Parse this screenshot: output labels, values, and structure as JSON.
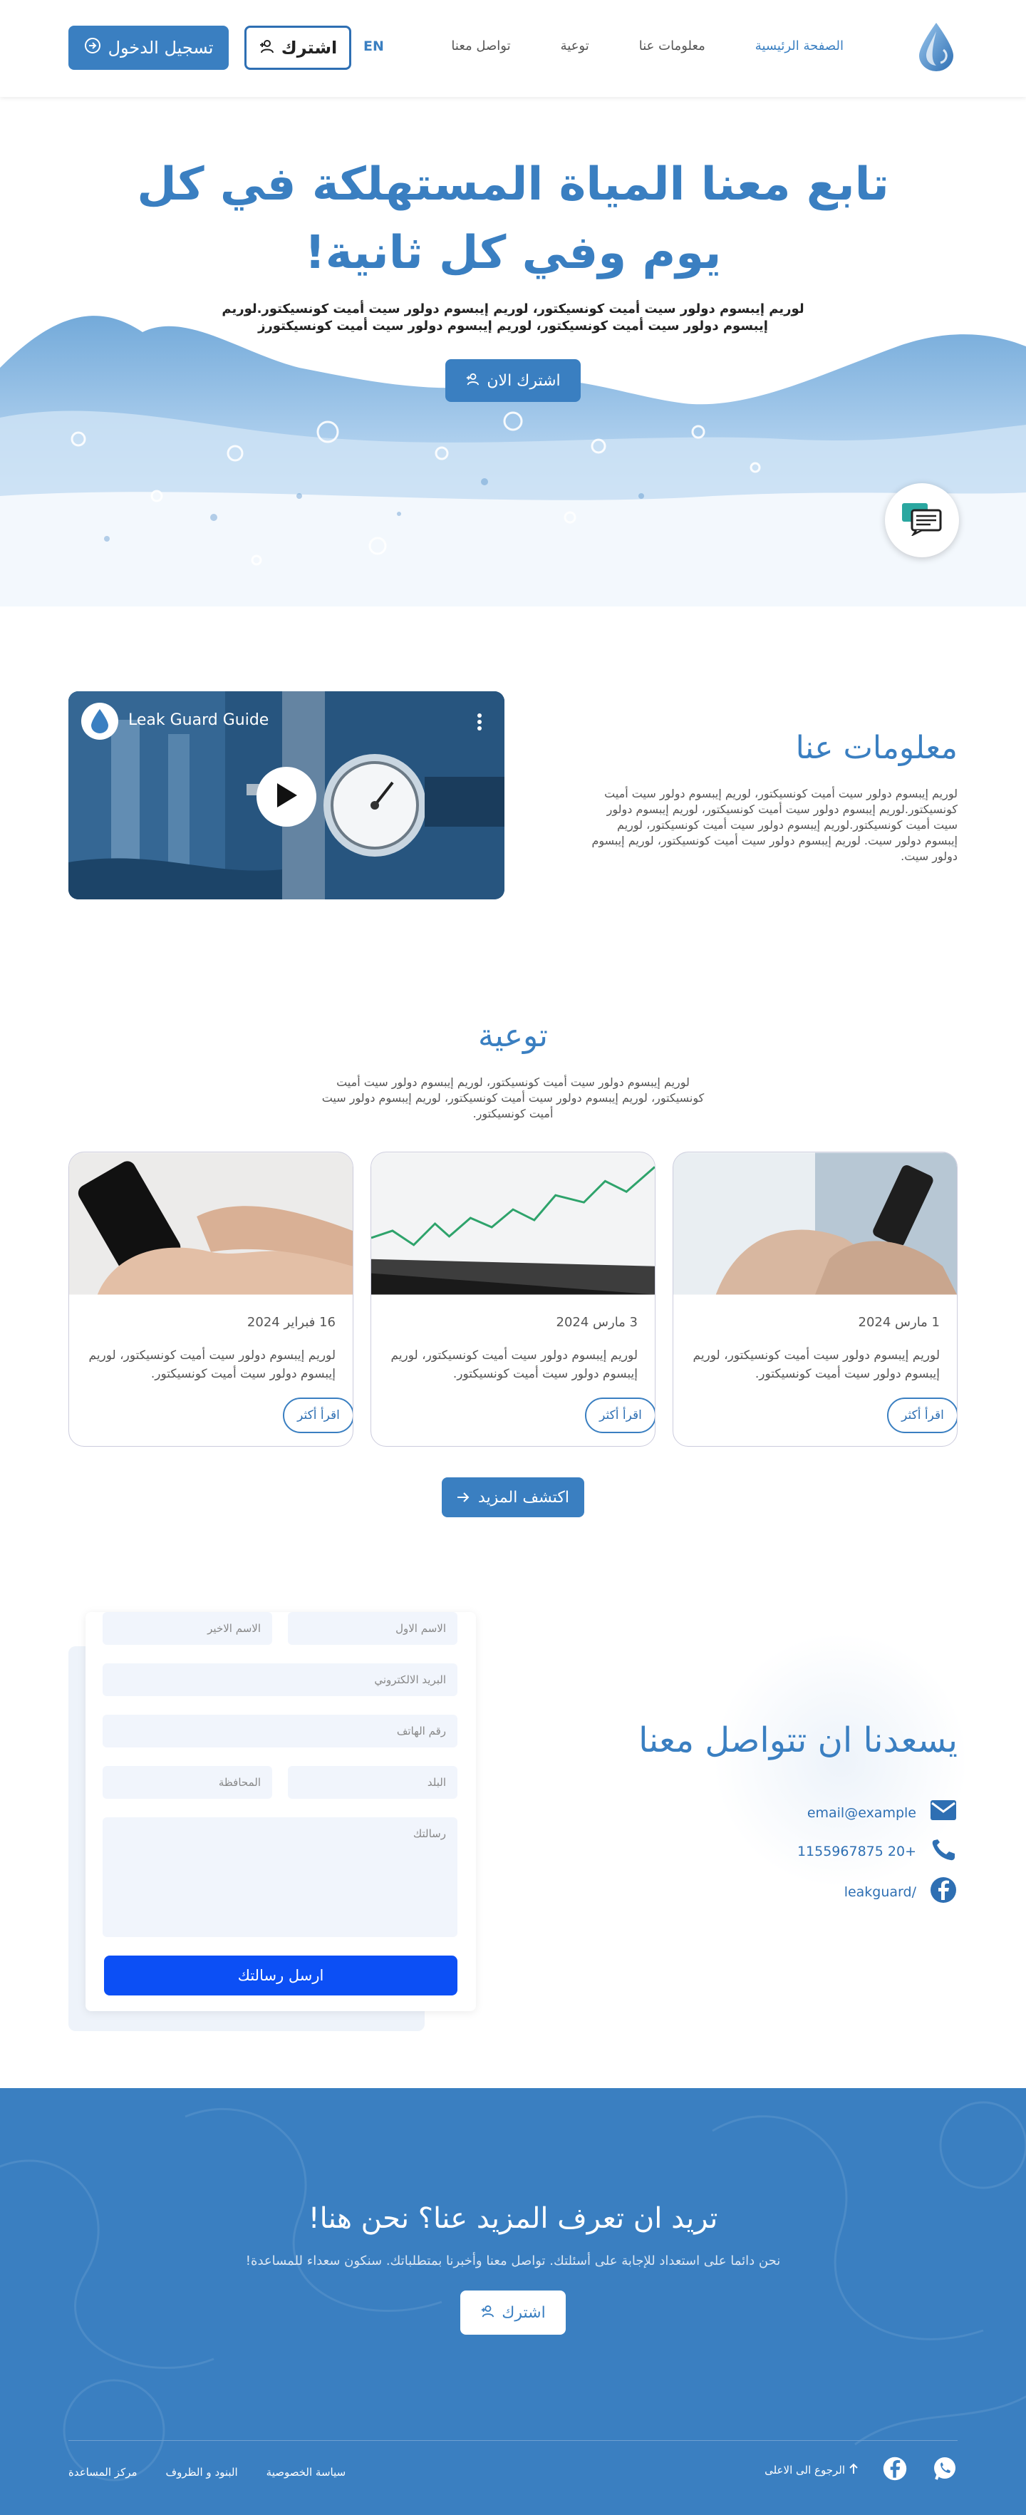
{
  "nav": {
    "items": [
      {
        "label": "الصفحة الرئيسية",
        "active": true
      },
      {
        "label": "معلومات عنا",
        "active": false
      },
      {
        "label": "توعية",
        "active": false
      },
      {
        "label": "تواصل معنا",
        "active": false
      }
    ],
    "lang": "EN",
    "subscribe_label": "اشترك",
    "login_label": "تسجيل الدخول"
  },
  "hero": {
    "title_line1": "تابع معنا المياة المستهلكة في كل",
    "title_line2": "يوم وفي كل ثانية!",
    "text": "لوريم إيبسوم دولور سيت أميت كونسيكتور، لوريم إيبسوم دولور سيت أميت كونسيكتور.لوريم إيبسوم دولور سيت أميت كونسيكتور، لوريم إيبسوم دولور سيت أميت كونسيكتورز",
    "cta_label": "اشترك الان"
  },
  "about": {
    "title": "معلومات عنا",
    "text": "لوريم إيبسوم دولور سيت أميت كونسيكتور، لوريم إيبسوم دولور سيت أميت كونسيكتور.لوريم إيبسوم دولور سيت أميت كونسيكتور، لوريم إيبسوم دولور سيت أميت كونسيكتور.لوريم إيبسوم دولور سيت أميت كونسيكتور، لوريم إيبسوم دولور سيت. لوريم إيبسوم دولور سيت أميت كونسيكتور، لوريم إيبسوم دولور سيت.",
    "video_title": "Leak Guard Guide"
  },
  "awareness": {
    "title": "توعية",
    "text": "لوريم إيبسوم دولور سيت أميت كونسيكتور، لوريم إيبسوم دولور سيت أميت كونسيكتور، لوريم إيبسوم دولور سيت أميت كونسيكتور، لوريم إيبسوم دولور سيت أميت كونسيكتور.",
    "cards": [
      {
        "date": "1 مارس 2024",
        "text": "لوريم إيبسوم دولور سيت أميت كونسيكتور، لوريم إيبسوم دولور سيت أميت كونسيكتور.",
        "more": "اقرأ أكثر"
      },
      {
        "date": "3 مارس 2024",
        "text": "لوريم إيبسوم دولور سيت أميت كونسيكتور، لوريم إيبسوم دولور سيت أميت كونسيكتور.",
        "more": "اقرأ أكثر"
      },
      {
        "date": "16 فبراير 2024",
        "text": "لوريم إيبسوم دولور سيت أميت كونسيكتور، لوريم إيبسوم دولور سيت أميت كونسيكتور.",
        "more": "اقرأ أكثر"
      }
    ],
    "explore_label": "اكتشف المزيد"
  },
  "contact": {
    "title": "يسعدنا ان تتواصل معنا",
    "email": "email@example",
    "phone": "+20 1155967875",
    "facebook": "/leakguard",
    "form": {
      "first_name": "الاسم الاول",
      "last_name": "الاسم الاخير",
      "email": "البريد الالكتروني",
      "phone": "رقم الهاتف",
      "country": "البلد",
      "governorate": "المحافظة",
      "message": "رسالتك",
      "send": "ارسل رسالتك"
    }
  },
  "footer": {
    "title": "تريد ان تعرف المزيد عنا؟ نحن هنا!",
    "text": "نحن دائما على استعداد للإجابة على أسئلتك. تواصل معنا وأخبرنا بمتطلباتك. سنكون سعداء للمساعدة!",
    "cta_label": "اشترك",
    "back_to_top": "الرجوع الى الاعلى",
    "links": [
      "مركز المساعدة",
      "البنود و الظروف",
      "سياسة الخصوصية"
    ]
  },
  "colors": {
    "primary": "#3a7fc1",
    "send_button": "#0c4ff5",
    "field_bg": "#f1f5fc"
  }
}
